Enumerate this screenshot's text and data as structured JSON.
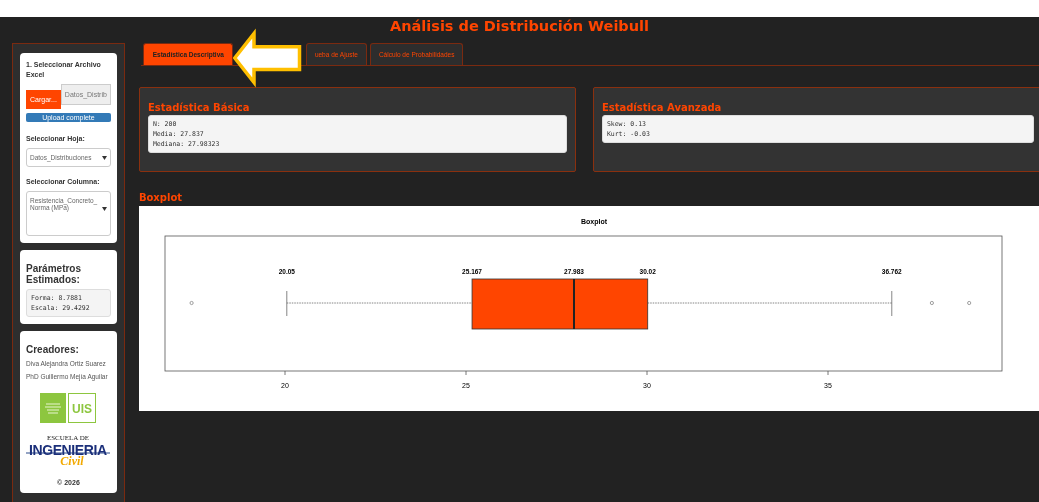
{
  "title": "Análisis de Distribución Weibull",
  "sidebar": {
    "upload": {
      "heading": "1. Seleccionar Archivo Excel",
      "button": "Cargar...",
      "file_name": "Datos_Distrib",
      "progress": {
        "label": "Upload complete",
        "level": 1
      }
    },
    "sheet": {
      "label": "Seleccionar Hoja:",
      "value": "Datos_Distribuciones"
    },
    "column": {
      "label": "Seleccionar Columna:",
      "value": "Resistencia_Concreto_Norma (MPa)"
    },
    "parameters": {
      "heading": "Parámetros Estimados:",
      "lines": [
        "Forma: 8.7881",
        "Escala: 29.4292"
      ]
    },
    "credits": {
      "heading": "Creadores:",
      "names": [
        "Diva Alejandra Ortiz Suarez",
        "PhD Guillermo Mejía Aguilar"
      ],
      "logos": [
        {
          "kind": "university",
          "mark": "UIS"
        },
        {
          "kind": "school",
          "top": "ESCUELA DE",
          "main": "INGENIERIA",
          "script": "Civil"
        }
      ],
      "copyright": "© 2026"
    }
  },
  "tabs": [
    {
      "label": "Estadística Descriptiva",
      "selected": true
    },
    {
      "label": "ueba de Ajuste",
      "selected": false
    },
    {
      "label": "Cálculo de Probabilidades",
      "selected": false
    }
  ],
  "panels": [
    {
      "title": "Estadística Básica",
      "lines": [
        "N: 200",
        "Media: 27.837",
        "Mediana: 27.98323"
      ]
    },
    {
      "title": "Estadística Avanzada",
      "lines": [
        "Skew: 0.13",
        "Kurt: -0.03"
      ]
    }
  ],
  "boxplot": {
    "heading": "Boxplot",
    "plot": {
      "title": "Boxplot",
      "stat_labels": [
        "20.05",
        "25.167",
        "27.983",
        "30.02",
        "36.762"
      ],
      "axis_labels": [
        "20",
        "25",
        "30",
        "35"
      ]
    }
  }
}
